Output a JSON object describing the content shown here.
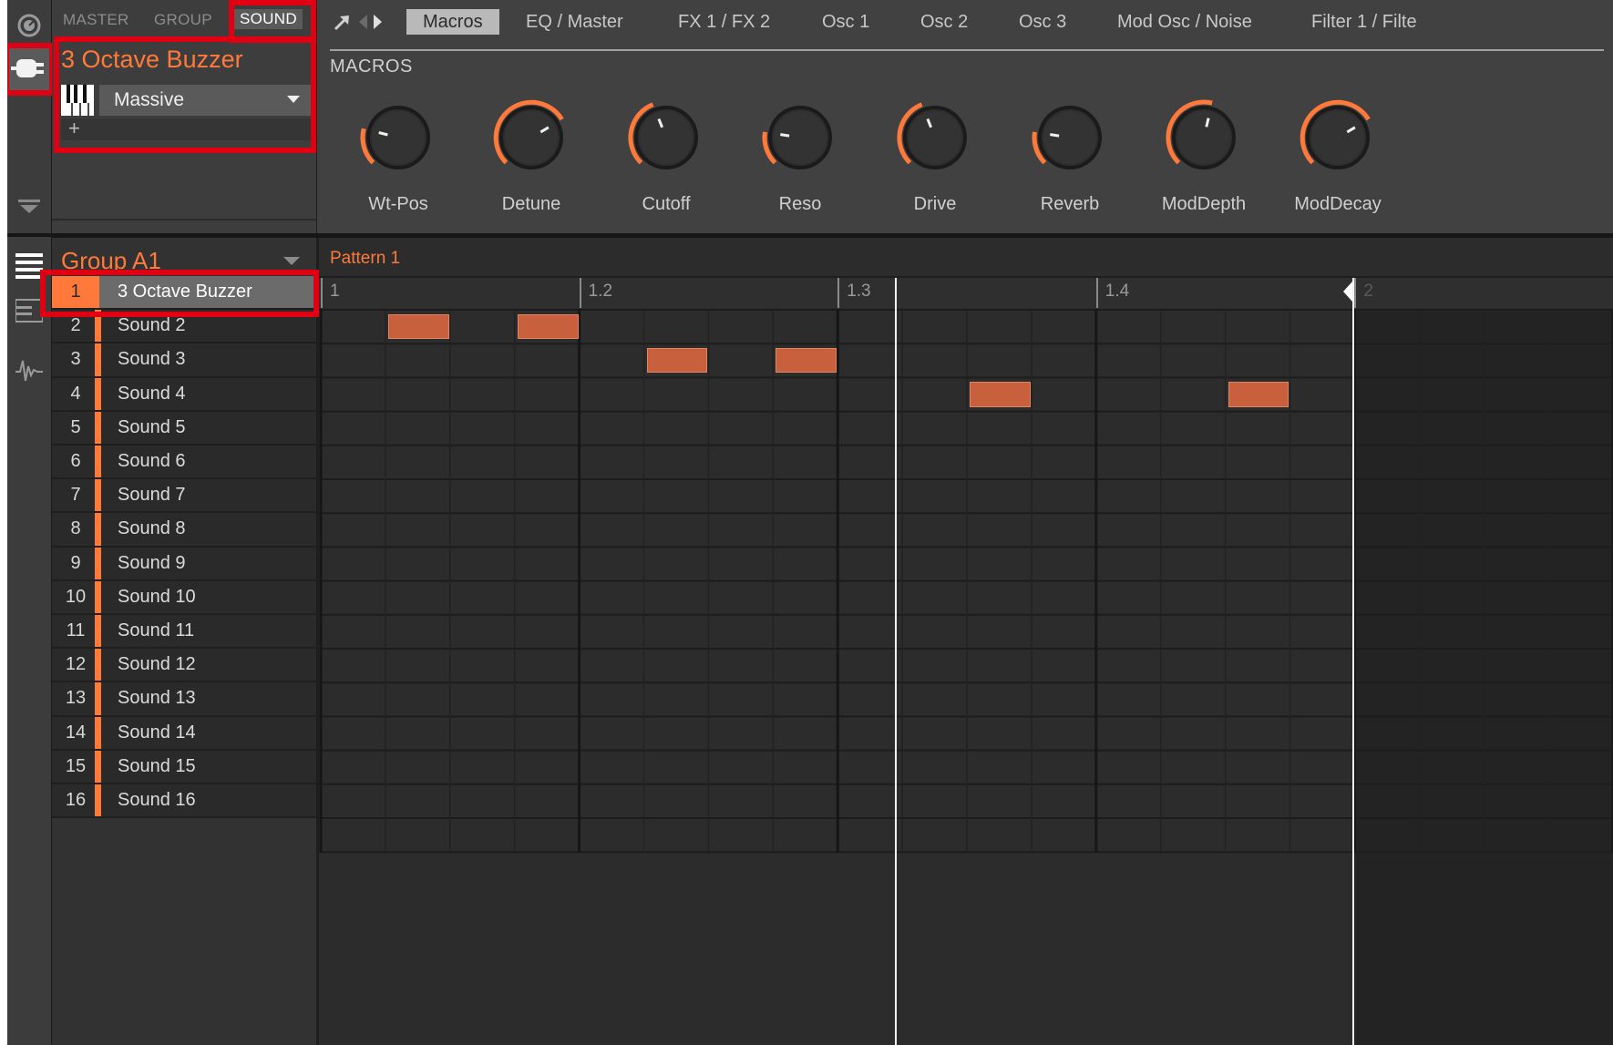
{
  "header": {
    "level_tabs": [
      "MASTER",
      "GROUP",
      "SOUND"
    ],
    "active_level_tab": "SOUND",
    "sound_name": "3 Octave Buzzer",
    "plugin_name": "Massive",
    "add_symbol": "+"
  },
  "page_tabs": [
    "Macros",
    "EQ / Master",
    "FX 1 / FX 2",
    "Osc 1",
    "Osc 2",
    "Osc 3",
    "Mod Osc / Noise",
    "Filter 1 / Filte"
  ],
  "active_page_tab": "Macros",
  "macros": {
    "section_label": "MACROS",
    "knobs": [
      {
        "label": "Wt-Pos",
        "value": 0.22
      },
      {
        "label": "Detune",
        "value": 0.72
      },
      {
        "label": "Cutoff",
        "value": 0.42
      },
      {
        "label": "Reso",
        "value": 0.2
      },
      {
        "label": "Drive",
        "value": 0.42
      },
      {
        "label": "Reverb",
        "value": 0.2
      },
      {
        "label": "ModDepth",
        "value": 0.55
      },
      {
        "label": "ModDecay",
        "value": 0.72
      }
    ]
  },
  "group": {
    "name": "Group A1",
    "sounds": [
      {
        "num": "1",
        "name": "3 Octave Buzzer"
      },
      {
        "num": "2",
        "name": "Sound 2"
      },
      {
        "num": "3",
        "name": "Sound 3"
      },
      {
        "num": "4",
        "name": "Sound 4"
      },
      {
        "num": "5",
        "name": "Sound 5"
      },
      {
        "num": "6",
        "name": "Sound 6"
      },
      {
        "num": "7",
        "name": "Sound 7"
      },
      {
        "num": "8",
        "name": "Sound 8"
      },
      {
        "num": "9",
        "name": "Sound 9"
      },
      {
        "num": "10",
        "name": "Sound 10"
      },
      {
        "num": "11",
        "name": "Sound 11"
      },
      {
        "num": "12",
        "name": "Sound 12"
      },
      {
        "num": "13",
        "name": "Sound 13"
      },
      {
        "num": "14",
        "name": "Sound 14"
      },
      {
        "num": "15",
        "name": "Sound 15"
      },
      {
        "num": "16",
        "name": "Sound 16"
      }
    ]
  },
  "pattern": {
    "name": "Pattern 1",
    "ruler": [
      "1",
      "1.2",
      "1.3",
      "1.4",
      "2"
    ],
    "notes": [
      {
        "row": 1,
        "step": 2
      },
      {
        "row": 1,
        "step": 4
      },
      {
        "row": 2,
        "step": 6
      },
      {
        "row": 2,
        "step": 8
      },
      {
        "row": 3,
        "step": 11
      },
      {
        "row": 3,
        "step": 15
      }
    ]
  },
  "colors": {
    "accent": "#ff7a3a",
    "note": "#c8603e",
    "highlight": "#e00012"
  }
}
